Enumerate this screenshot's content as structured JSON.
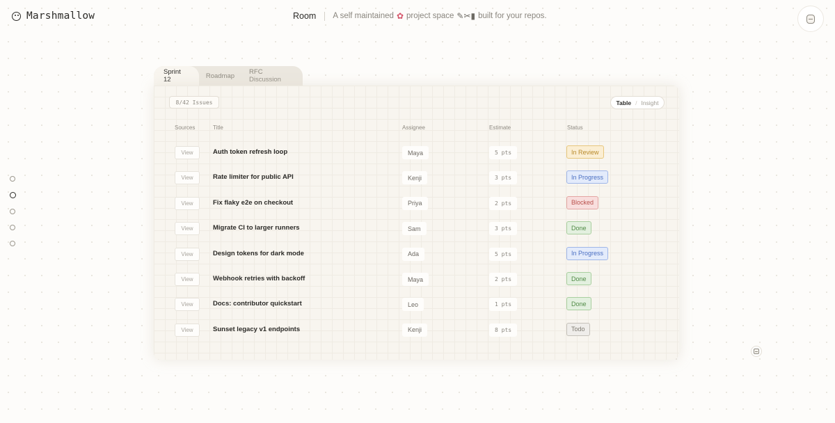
{
  "app": {
    "name": "Marshmallow"
  },
  "header": {
    "room_label": "Room",
    "tagline_prefix": "A self maintained",
    "tagline_flower": "✿",
    "tagline_middle": "project space",
    "tagline_tools": "✎✂▮",
    "tagline_suffix": "built for your repos."
  },
  "tabs": [
    {
      "label": "Sprint 12",
      "active": true
    },
    {
      "label": "Roadmap",
      "active": false
    },
    {
      "label": "RFC Discussion",
      "active": false
    }
  ],
  "toolbar": {
    "issue_count": "8/42 Issues",
    "view_toggle": {
      "table": "Table",
      "insight": "Insight",
      "selected": "Table"
    }
  },
  "table": {
    "headers": {
      "sources": "Sources",
      "title": "Title",
      "assignee": "Assignee",
      "estimate": "Estimate",
      "status": "Status"
    },
    "rows": [
      {
        "view": "View",
        "title": "Auth token refresh loop",
        "assignee": "Maya",
        "estimate": "5 pts",
        "status": "In Review"
      },
      {
        "view": "View",
        "title": "Rate limiter for public API",
        "assignee": "Kenji",
        "estimate": "3 pts",
        "status": "In Progress"
      },
      {
        "view": "View",
        "title": "Fix flaky e2e on checkout",
        "assignee": "Priya",
        "estimate": "2 pts",
        "status": "Blocked"
      },
      {
        "view": "View",
        "title": "Migrate CI to larger runners",
        "assignee": "Sam",
        "estimate": "3 pts",
        "status": "Done"
      },
      {
        "view": "View",
        "title": "Design tokens for dark mode",
        "assignee": "Ada",
        "estimate": "5 pts",
        "status": "In Progress"
      },
      {
        "view": "View",
        "title": "Webhook retries with backoff",
        "assignee": "Maya",
        "estimate": "2 pts",
        "status": "Done"
      },
      {
        "view": "View",
        "title": "Docs: contributor quickstart",
        "assignee": "Leo",
        "estimate": "1 pts",
        "status": "Done"
      },
      {
        "view": "View",
        "title": "Sunset legacy v1 endpoints",
        "assignee": "Kenji",
        "estimate": "8 pts",
        "status": "Todo"
      }
    ]
  },
  "status_colors": {
    "In Review": {
      "bg": "#fbeed3",
      "border": "#e7c77c",
      "text": "#b88a2b"
    },
    "In Progress": {
      "bg": "#e3ebfb",
      "border": "#9fb6e8",
      "text": "#4a6fc2"
    },
    "Blocked": {
      "bg": "#f8dedd",
      "border": "#e3a5a2",
      "text": "#b9504b"
    },
    "Done": {
      "bg": "#e3f0df",
      "border": "#a9cf9f",
      "text": "#4f8a45"
    },
    "Todo": {
      "bg": "#efedea",
      "border": "#c5c1ba",
      "text": "#7d7970"
    }
  },
  "side_nav": {
    "dots": 5,
    "active_index": 1
  }
}
